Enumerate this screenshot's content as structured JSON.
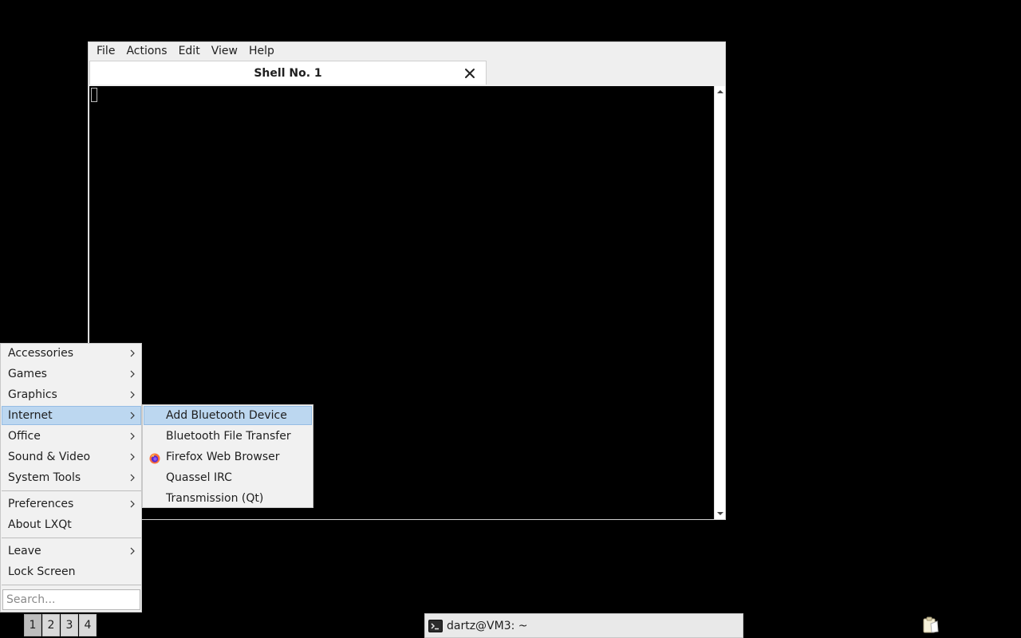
{
  "terminal": {
    "menubar": [
      "File",
      "Actions",
      "Edit",
      "View",
      "Help"
    ],
    "tab_title": "Shell No. 1"
  },
  "main_menu": {
    "items": [
      {
        "label": "Accessories",
        "has_submenu": true
      },
      {
        "label": "Games",
        "has_submenu": true
      },
      {
        "label": "Graphics",
        "has_submenu": true
      },
      {
        "label": "Internet",
        "has_submenu": true,
        "highlighted": true
      },
      {
        "label": "Office",
        "has_submenu": true
      },
      {
        "label": "Sound & Video",
        "has_submenu": true
      },
      {
        "label": "System Tools",
        "has_submenu": true
      },
      {
        "label": "Preferences",
        "has_submenu": true
      },
      {
        "label": "About LXQt",
        "has_submenu": false
      },
      {
        "label": "Leave",
        "has_submenu": true
      },
      {
        "label": "Lock Screen",
        "has_submenu": false
      }
    ],
    "search_placeholder": "Search..."
  },
  "internet_submenu": {
    "items": [
      {
        "label": "Add Bluetooth Device",
        "icon": "none",
        "highlighted": true
      },
      {
        "label": "Bluetooth File Transfer",
        "icon": "none"
      },
      {
        "label": "Firefox Web Browser",
        "icon": "firefox-icon"
      },
      {
        "label": "Quassel IRC",
        "icon": "none"
      },
      {
        "label": "Transmission (Qt)",
        "icon": "none"
      }
    ]
  },
  "taskbar": {
    "desktops": [
      "1",
      "2",
      "3",
      "4"
    ],
    "active_desktop": "1",
    "task_label": "dartz@VM3: ~",
    "tray_icon": "clipboard-icon"
  },
  "colors": {
    "highlight_bg": "#bcd7f0",
    "highlight_border": "#95bde4",
    "menu_bg": "#f1f1f1",
    "desktop_bg": "#000000"
  }
}
